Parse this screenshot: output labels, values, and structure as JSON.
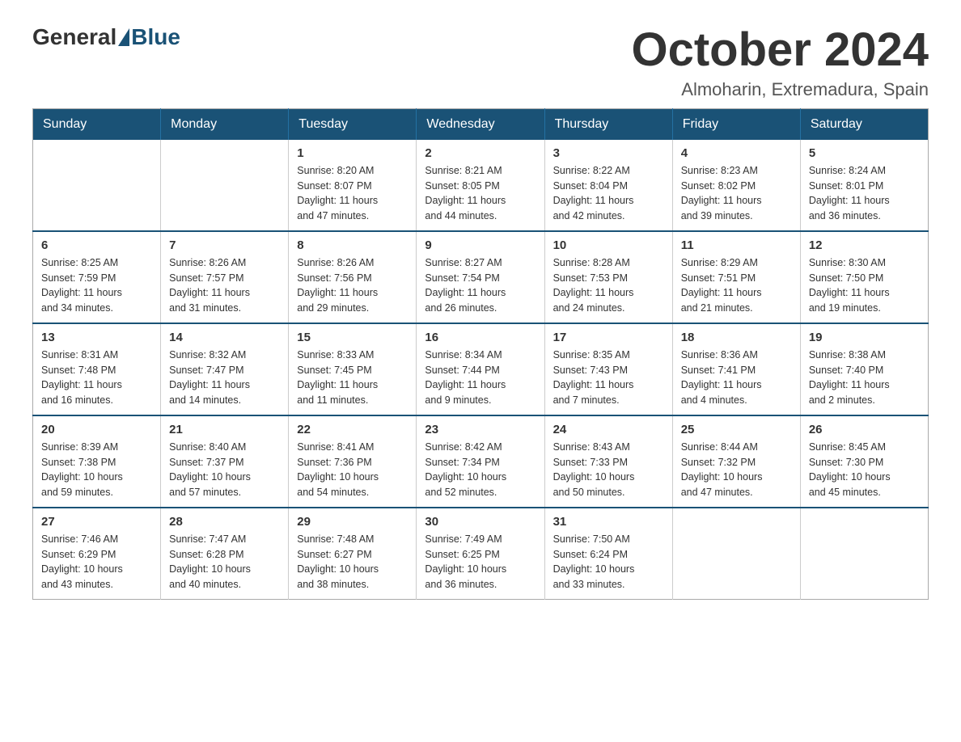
{
  "logo": {
    "text_general": "General",
    "text_blue": "Blue"
  },
  "header": {
    "month": "October 2024",
    "location": "Almoharin, Extremadura, Spain"
  },
  "weekdays": [
    "Sunday",
    "Monday",
    "Tuesday",
    "Wednesday",
    "Thursday",
    "Friday",
    "Saturday"
  ],
  "weeks": [
    [
      {
        "day": "",
        "info": ""
      },
      {
        "day": "",
        "info": ""
      },
      {
        "day": "1",
        "info": "Sunrise: 8:20 AM\nSunset: 8:07 PM\nDaylight: 11 hours\nand 47 minutes."
      },
      {
        "day": "2",
        "info": "Sunrise: 8:21 AM\nSunset: 8:05 PM\nDaylight: 11 hours\nand 44 minutes."
      },
      {
        "day": "3",
        "info": "Sunrise: 8:22 AM\nSunset: 8:04 PM\nDaylight: 11 hours\nand 42 minutes."
      },
      {
        "day": "4",
        "info": "Sunrise: 8:23 AM\nSunset: 8:02 PM\nDaylight: 11 hours\nand 39 minutes."
      },
      {
        "day": "5",
        "info": "Sunrise: 8:24 AM\nSunset: 8:01 PM\nDaylight: 11 hours\nand 36 minutes."
      }
    ],
    [
      {
        "day": "6",
        "info": "Sunrise: 8:25 AM\nSunset: 7:59 PM\nDaylight: 11 hours\nand 34 minutes."
      },
      {
        "day": "7",
        "info": "Sunrise: 8:26 AM\nSunset: 7:57 PM\nDaylight: 11 hours\nand 31 minutes."
      },
      {
        "day": "8",
        "info": "Sunrise: 8:26 AM\nSunset: 7:56 PM\nDaylight: 11 hours\nand 29 minutes."
      },
      {
        "day": "9",
        "info": "Sunrise: 8:27 AM\nSunset: 7:54 PM\nDaylight: 11 hours\nand 26 minutes."
      },
      {
        "day": "10",
        "info": "Sunrise: 8:28 AM\nSunset: 7:53 PM\nDaylight: 11 hours\nand 24 minutes."
      },
      {
        "day": "11",
        "info": "Sunrise: 8:29 AM\nSunset: 7:51 PM\nDaylight: 11 hours\nand 21 minutes."
      },
      {
        "day": "12",
        "info": "Sunrise: 8:30 AM\nSunset: 7:50 PM\nDaylight: 11 hours\nand 19 minutes."
      }
    ],
    [
      {
        "day": "13",
        "info": "Sunrise: 8:31 AM\nSunset: 7:48 PM\nDaylight: 11 hours\nand 16 minutes."
      },
      {
        "day": "14",
        "info": "Sunrise: 8:32 AM\nSunset: 7:47 PM\nDaylight: 11 hours\nand 14 minutes."
      },
      {
        "day": "15",
        "info": "Sunrise: 8:33 AM\nSunset: 7:45 PM\nDaylight: 11 hours\nand 11 minutes."
      },
      {
        "day": "16",
        "info": "Sunrise: 8:34 AM\nSunset: 7:44 PM\nDaylight: 11 hours\nand 9 minutes."
      },
      {
        "day": "17",
        "info": "Sunrise: 8:35 AM\nSunset: 7:43 PM\nDaylight: 11 hours\nand 7 minutes."
      },
      {
        "day": "18",
        "info": "Sunrise: 8:36 AM\nSunset: 7:41 PM\nDaylight: 11 hours\nand 4 minutes."
      },
      {
        "day": "19",
        "info": "Sunrise: 8:38 AM\nSunset: 7:40 PM\nDaylight: 11 hours\nand 2 minutes."
      }
    ],
    [
      {
        "day": "20",
        "info": "Sunrise: 8:39 AM\nSunset: 7:38 PM\nDaylight: 10 hours\nand 59 minutes."
      },
      {
        "day": "21",
        "info": "Sunrise: 8:40 AM\nSunset: 7:37 PM\nDaylight: 10 hours\nand 57 minutes."
      },
      {
        "day": "22",
        "info": "Sunrise: 8:41 AM\nSunset: 7:36 PM\nDaylight: 10 hours\nand 54 minutes."
      },
      {
        "day": "23",
        "info": "Sunrise: 8:42 AM\nSunset: 7:34 PM\nDaylight: 10 hours\nand 52 minutes."
      },
      {
        "day": "24",
        "info": "Sunrise: 8:43 AM\nSunset: 7:33 PM\nDaylight: 10 hours\nand 50 minutes."
      },
      {
        "day": "25",
        "info": "Sunrise: 8:44 AM\nSunset: 7:32 PM\nDaylight: 10 hours\nand 47 minutes."
      },
      {
        "day": "26",
        "info": "Sunrise: 8:45 AM\nSunset: 7:30 PM\nDaylight: 10 hours\nand 45 minutes."
      }
    ],
    [
      {
        "day": "27",
        "info": "Sunrise: 7:46 AM\nSunset: 6:29 PM\nDaylight: 10 hours\nand 43 minutes."
      },
      {
        "day": "28",
        "info": "Sunrise: 7:47 AM\nSunset: 6:28 PM\nDaylight: 10 hours\nand 40 minutes."
      },
      {
        "day": "29",
        "info": "Sunrise: 7:48 AM\nSunset: 6:27 PM\nDaylight: 10 hours\nand 38 minutes."
      },
      {
        "day": "30",
        "info": "Sunrise: 7:49 AM\nSunset: 6:25 PM\nDaylight: 10 hours\nand 36 minutes."
      },
      {
        "day": "31",
        "info": "Sunrise: 7:50 AM\nSunset: 6:24 PM\nDaylight: 10 hours\nand 33 minutes."
      },
      {
        "day": "",
        "info": ""
      },
      {
        "day": "",
        "info": ""
      }
    ]
  ]
}
